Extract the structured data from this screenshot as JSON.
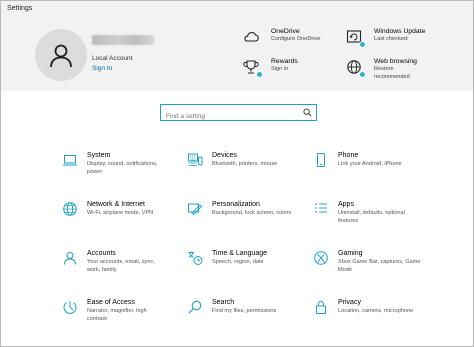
{
  "window": {
    "title": "Settings"
  },
  "account": {
    "type_label": "Local Account",
    "sign_in_label": "Sign In"
  },
  "services": [
    {
      "title": "OneDrive",
      "desc": [
        "Configure OneDrive"
      ],
      "icon": "cloud-icon"
    },
    {
      "title": "Windows Update",
      "desc": [
        "Last checked:"
      ],
      "icon": "update-icon"
    },
    {
      "title": "Rewards",
      "desc": [
        "Sign In"
      ],
      "icon": "trophy-icon"
    },
    {
      "title": "Web browsing",
      "desc": [
        "Restore",
        "recommended"
      ],
      "icon": "globe-icon"
    }
  ],
  "search": {
    "placeholder": "Find a setting"
  },
  "accent_color": "#1ba1c6",
  "categories": [
    {
      "title": "System",
      "desc": [
        "Display, sound, notifications,",
        "power"
      ],
      "icon": "laptop-icon"
    },
    {
      "title": "Devices",
      "desc": [
        "Bluetooth, printers, mouse"
      ],
      "icon": "keyboard-icon"
    },
    {
      "title": "Phone",
      "desc": [
        "Link your Android, iPhone"
      ],
      "icon": "phone-icon"
    },
    {
      "title": "Network & Internet",
      "desc": [
        "Wi-Fi, airplane mode, VPN"
      ],
      "icon": "globe-icon"
    },
    {
      "title": "Personalization",
      "desc": [
        "Background, lock screen, colors"
      ],
      "icon": "paint-icon"
    },
    {
      "title": "Apps",
      "desc": [
        "Uninstall, defaults, optional",
        "features"
      ],
      "icon": "apps-icon"
    },
    {
      "title": "Accounts",
      "desc": [
        "Your accounts, email, sync,",
        "work, family"
      ],
      "icon": "person-icon"
    },
    {
      "title": "Time & Language",
      "desc": [
        "Speech, region, date"
      ],
      "icon": "time-language-icon"
    },
    {
      "title": "Gaming",
      "desc": [
        "Xbox Game Bar, captures, Game",
        "Mode"
      ],
      "icon": "xbox-icon"
    },
    {
      "title": "Ease of Access",
      "desc": [
        "Narrator, magnifier, high",
        "contrast"
      ],
      "icon": "ease-of-access-icon"
    },
    {
      "title": "Search",
      "desc": [
        "Find my files, permissions"
      ],
      "icon": "search-icon"
    },
    {
      "title": "Privacy",
      "desc": [
        "Location, camera, microphone"
      ],
      "icon": "lock-icon"
    }
  ]
}
